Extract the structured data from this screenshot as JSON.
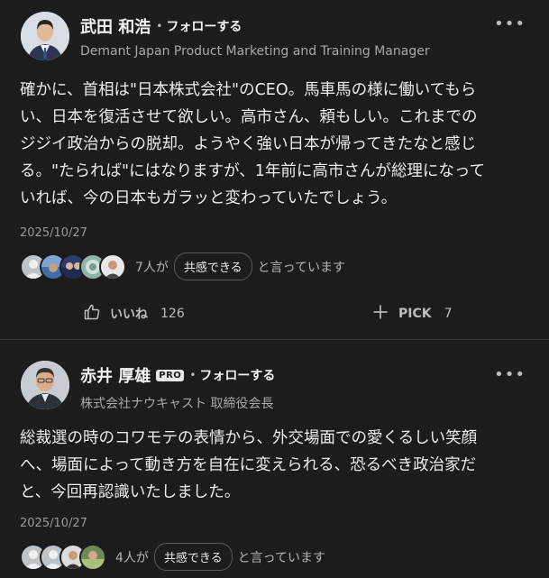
{
  "posts": [
    {
      "name": "武田 和浩",
      "follow_label": "フォローする",
      "title": "Demant Japan Product Marketing and Training Manager",
      "comment_lines": [
        "確かに、首相は\"日本株式会社\"のCEO。馬車馬の様に働いてもら",
        "い、日本を復活させて欲しい。高市さん、頼もしい。これまでの",
        "ジジイ政治からの脱却。ようやく強い日本が帰ってきたなと感じ",
        "る。\"たられば\"にはなりますが、1年前に高市さんが総理になって",
        "いれば、今の日本もガラッと変わっていたでしょう。"
      ],
      "date": "2025/10/27",
      "reaction_count": "7人が",
      "reaction_chip": "共感できる",
      "reaction_suffix": "と言っています",
      "like_label": "いいね",
      "like_count": "126",
      "pick_label": "PICK",
      "pick_count": "7"
    },
    {
      "name": "赤井 厚雄",
      "pro_badge": "PRO",
      "follow_label": "フォローする",
      "title": "株式会社ナウキャスト 取締役会長",
      "comment_lines": [
        "総裁選の時のコワモテの表情から、外交場面での愛くるしい笑顔",
        "へ、場面によって動き方を自在に変えられる、恐るべき政治家だ",
        "と、今回再認識いたしました。"
      ],
      "date": "2025/10/27",
      "reaction_count": "4人が",
      "reaction_chip": "共感できる",
      "reaction_suffix": "と言っています"
    }
  ],
  "icons": [
    "more-icon",
    "thumbs-up-icon",
    "plus-icon"
  ],
  "colors": {
    "background": "#1c1c1c",
    "divider": "#3a3a3a",
    "text": "#ececec",
    "muted": "#9a9a9a"
  }
}
